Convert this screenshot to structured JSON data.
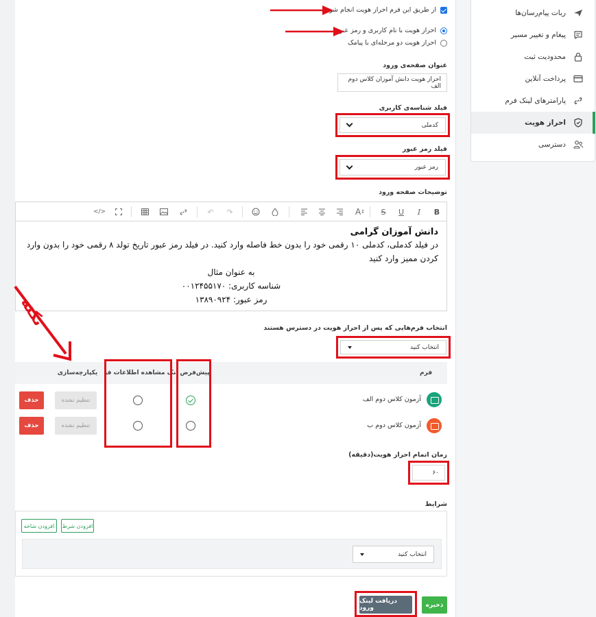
{
  "sidebar": {
    "items": [
      {
        "label": "ربات پیام‌رسان‌ها",
        "icon": "send-icon"
      },
      {
        "label": "پیغام و تغییر مسیر",
        "icon": "message-icon"
      },
      {
        "label": "محدودیت ثبت",
        "icon": "lock-icon"
      },
      {
        "label": "پرداخت آنلاین",
        "icon": "card-icon"
      },
      {
        "label": "پارامترهای لینک فرم",
        "icon": "link-icon"
      },
      {
        "label": "احراز هویت",
        "icon": "shield-icon"
      },
      {
        "label": "دسترسی",
        "icon": "users-icon"
      }
    ],
    "active_index": 5,
    "accent": "#2e9e5b"
  },
  "auth": {
    "enable_label": "از طریق این فرم احراز هویت انجام شود.",
    "enabled": true,
    "method_password": "احراز هویت با نام کاربری و رمز عبور",
    "method_sms": "احراز هویت دو مرحله‌ای با پیامک",
    "selected_method": "password"
  },
  "login_title": {
    "label": "عنوان صفحه‌ی ورود",
    "value": "احراز هویت دانش آموزان کلاس دوم الف"
  },
  "username_field": {
    "label": "فیلد شناسه‌ی کاربری",
    "value": "کدملی"
  },
  "password_field": {
    "label": "فیلد رمز عبور",
    "value": "رمز عبور"
  },
  "description": {
    "label": "توضیحات صفحه ورود",
    "line1": "دانش آموزان گرامی",
    "line2": "در فیلد کدملی، کدملی ۱۰ رقمی خود را بدون خط فاصله وارد کنید.  در فیلد رمز عبور تاریخ تولد ۸ رقمی خود را بدون وارد",
    "line3": "کردن ممیز وارد کنید",
    "line4": "به عنوان مثال",
    "line5": "شناسه کاربری: ۰۰۱۲۴۵۵۱۷۰",
    "line6": "رمز عبور: ۱۳۸۹۰۹۲۴"
  },
  "forms_select": {
    "label": "انتخاب فرم‌هایی که پس از احراز هویت در دسترس هستند",
    "value": "انتخاب کنید"
  },
  "table": {
    "headers": {
      "form": "فرم",
      "default": "پیش‌فرض",
      "view_link": "لینک مشاهده اطلاعات فرم",
      "integration": "یکپارچه‌سازی"
    },
    "rows": [
      {
        "name": "آزمون کلاس دوم الف",
        "color": "#1aa37a",
        "default": true,
        "integration": "تنظیم نشده",
        "delete": "حذف"
      },
      {
        "name": "آزمون کلاس دوم ب",
        "color": "#f15a2b",
        "default": false,
        "integration": "تنظیم نشده",
        "delete": "حذف"
      }
    ]
  },
  "timeout": {
    "label": "زمان اتمام احراز هویت(دقیقه)",
    "value": "۶۰"
  },
  "conditions": {
    "label": "شرایط",
    "add_condition": "افزودن شرط",
    "add_branch": "افزودن شاخه",
    "select_value": "انتخاب کنید"
  },
  "footer": {
    "save": "ذخیره",
    "get_link": "دریافت لینک ورود"
  },
  "annotation": {
    "note": "نکته",
    "color": "#e0101a"
  }
}
